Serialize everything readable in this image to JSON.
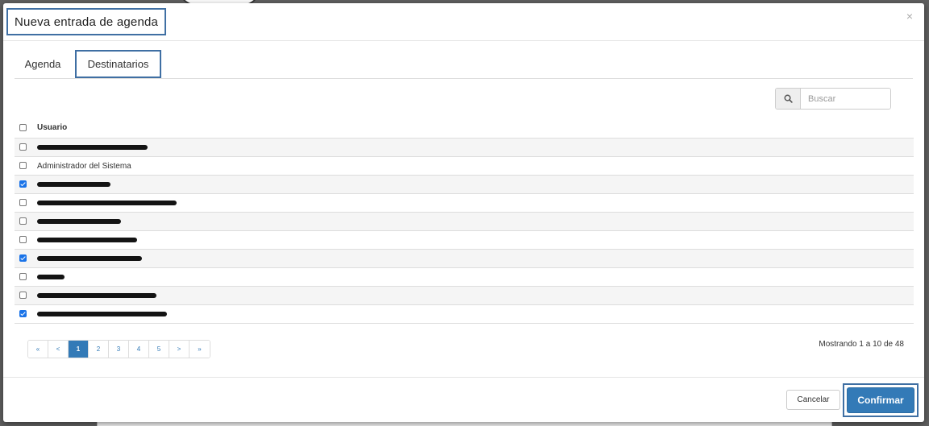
{
  "modal": {
    "title": "Nueva entrada de agenda",
    "close_icon": "close-icon"
  },
  "tabs": [
    {
      "label": "Agenda",
      "active": false
    },
    {
      "label": "Destinatarios",
      "active": true
    }
  ],
  "search": {
    "icon": "search-icon",
    "placeholder": "Buscar",
    "value": ""
  },
  "table": {
    "header": "Usuario",
    "rows": [
      {
        "name": "",
        "redacted": true,
        "checked": false
      },
      {
        "name": "Administrador del Sistema",
        "redacted": false,
        "checked": false
      },
      {
        "name": "",
        "redacted": true,
        "checked": true
      },
      {
        "name": "",
        "redacted": true,
        "checked": false
      },
      {
        "name": "",
        "redacted": true,
        "checked": false
      },
      {
        "name": "",
        "redacted": true,
        "checked": false
      },
      {
        "name": "",
        "redacted": true,
        "checked": true
      },
      {
        "name": "",
        "redacted": true,
        "checked": false
      },
      {
        "name": "",
        "redacted": true,
        "checked": false
      },
      {
        "name": "",
        "redacted": true,
        "checked": true
      }
    ]
  },
  "pagination": {
    "first": "«",
    "prev": "<",
    "pages": [
      "1",
      "2",
      "3",
      "4",
      "5"
    ],
    "current": "1",
    "next": ">",
    "last": "»",
    "info": "Mostrando 1 a 10 de 48"
  },
  "footer": {
    "cancel_label": "Cancelar",
    "confirm_label": "Confirmar"
  },
  "colors": {
    "primary": "#337ab7",
    "highlight_border": "#3f6fa3",
    "checkbox_checked": "#1a73e8"
  }
}
